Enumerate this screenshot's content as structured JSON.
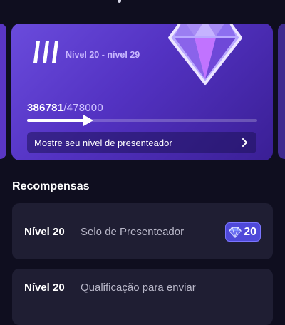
{
  "level_card": {
    "range": "Nível 20 - nível 29",
    "points_current": "386781",
    "points_separator": "/",
    "points_total": "478000",
    "progress": 0.266,
    "cta_label": "Mostre seu nível de presenteador"
  },
  "rewards": {
    "title": "Recompensas",
    "items": [
      {
        "level": "Nível 20",
        "name": "Selo de Presenteador",
        "badge": "20"
      },
      {
        "level": "Nível 20",
        "name": "Qualificação para enviar"
      }
    ]
  },
  "colors": {
    "background": "#0f0e1f",
    "card_gradient_start": "#6a4bdc",
    "card_gradient_end": "#3a1f95",
    "reward_row": "#1f1e33",
    "badge": "#4f49d9",
    "gem_face": "#c173ff"
  }
}
